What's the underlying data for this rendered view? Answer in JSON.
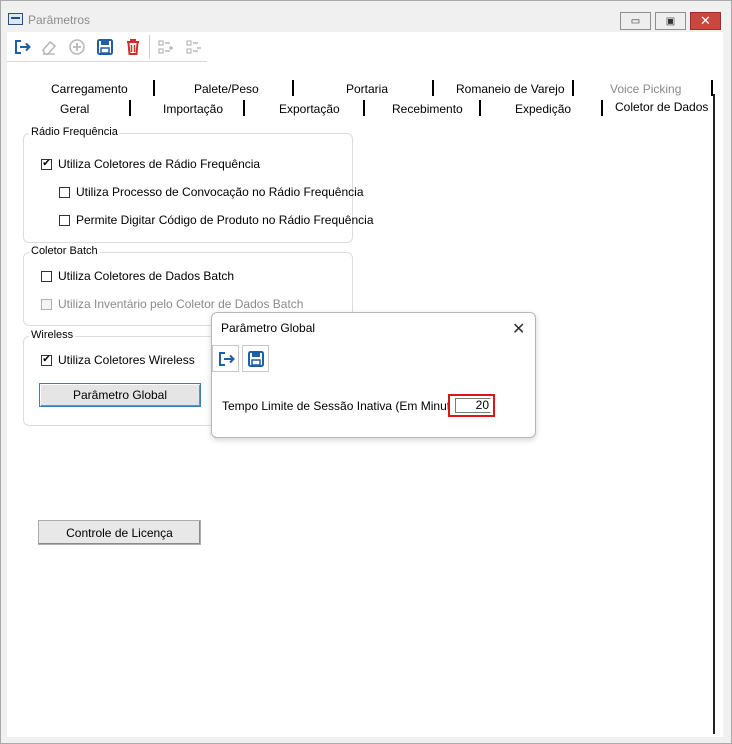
{
  "window": {
    "title": "Parâmetros",
    "controls": {
      "minimize": "▭",
      "maximize": "▣",
      "close": "✕"
    }
  },
  "toolbar": {
    "icons": [
      "exit-icon",
      "eraser-icon",
      "add-circle-icon",
      "save-icon",
      "delete-icon",
      "add-list-icon",
      "remove-list-icon"
    ]
  },
  "tabs": {
    "row1": [
      "Carregamento",
      "Palete/Peso",
      "Portaria",
      "Romaneio de Varejo",
      "Voice Picking"
    ],
    "row2": [
      "Geral",
      "Importação",
      "Exportação",
      "Recebimento",
      "Expedição",
      "Coletor de Dados"
    ],
    "active": "Coletor de Dados"
  },
  "radio_frequencia": {
    "title": "Rádio Frequência",
    "use_collectors": {
      "label": "Utiliza Coletores de Rádio Frequência",
      "checked": true
    },
    "use_convocation": {
      "label": "Utiliza Processo de Convocação no Rádio Frequência",
      "checked": false
    },
    "allow_typing": {
      "label": "Permite Digitar Código de Produto no Rádio Frequência",
      "checked": false
    }
  },
  "coletor_batch": {
    "title": "Coletor Batch",
    "use_batch": {
      "label": "Utiliza Coletores de Dados Batch",
      "checked": false
    },
    "use_inventory": {
      "label": "Utiliza Inventário pelo Coletor de Dados Batch",
      "checked": false
    }
  },
  "wireless": {
    "title": "Wireless",
    "use_wireless": {
      "label": "Utiliza Coletores Wireless",
      "checked": true
    },
    "global_button": "Parâmetro Global"
  },
  "license_button": "Controle de Licença",
  "dialog": {
    "title": "Parâmetro Global",
    "close": "✕",
    "timeout_label": "Tempo Limite de Sessão Inativa (Em Minutos)",
    "timeout_value": "20"
  },
  "colors": {
    "accent_blue": "#1f5fa8",
    "delete_red": "#d12b2b",
    "highlight_red": "#d8161b"
  }
}
